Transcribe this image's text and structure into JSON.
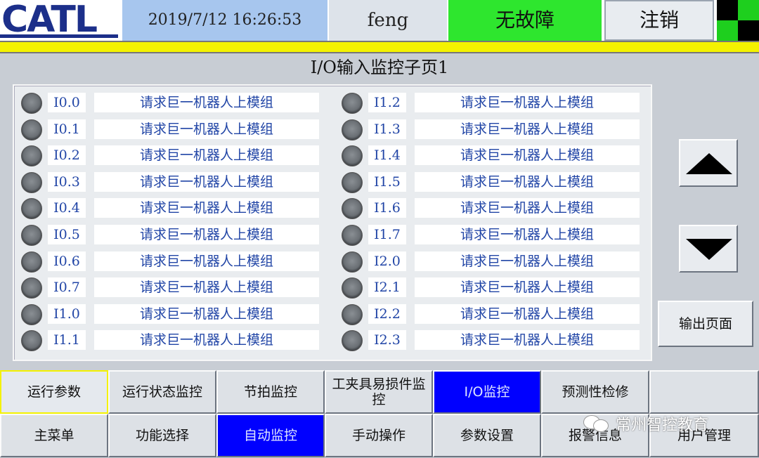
{
  "header": {
    "logo_text": "CATL",
    "datetime": "2019/7/12  16:26:53",
    "user": "feng",
    "status": "无故障",
    "logout_label": "注销"
  },
  "colors": {
    "status_ok": "#2ee62e",
    "active_tab": "#0000ff",
    "alarm_bar": "#f4f200",
    "datetime_bg": "#a7c6ee"
  },
  "page_title": "I/O输入监控子页1",
  "io_left": [
    {
      "addr": "I0.0",
      "desc": "请求巨一机器人上模组",
      "state": "off"
    },
    {
      "addr": "I0.1",
      "desc": "请求巨一机器人上模组",
      "state": "off"
    },
    {
      "addr": "I0.2",
      "desc": "请求巨一机器人上模组",
      "state": "off"
    },
    {
      "addr": "I0.3",
      "desc": "请求巨一机器人上模组",
      "state": "off"
    },
    {
      "addr": "I0.4",
      "desc": "请求巨一机器人上模组",
      "state": "off"
    },
    {
      "addr": "I0.5",
      "desc": "请求巨一机器人上模组",
      "state": "off"
    },
    {
      "addr": "I0.6",
      "desc": "请求巨一机器人上模组",
      "state": "off"
    },
    {
      "addr": "I0.7",
      "desc": "请求巨一机器人上模组",
      "state": "off"
    },
    {
      "addr": "I1.0",
      "desc": "请求巨一机器人上模组",
      "state": "off"
    },
    {
      "addr": "I1.1",
      "desc": "请求巨一机器人上模组",
      "state": "off"
    }
  ],
  "io_right": [
    {
      "addr": "I1.2",
      "desc": "请求巨一机器人上模组",
      "state": "off"
    },
    {
      "addr": "I1.3",
      "desc": "请求巨一机器人上模组",
      "state": "off"
    },
    {
      "addr": "I1.4",
      "desc": "请求巨一机器人上模组",
      "state": "off"
    },
    {
      "addr": "I1.5",
      "desc": "请求巨一机器人上模组",
      "state": "off"
    },
    {
      "addr": "I1.6",
      "desc": "请求巨一机器人上模组",
      "state": "off"
    },
    {
      "addr": "I1.7",
      "desc": "请求巨一机器人上模组",
      "state": "off"
    },
    {
      "addr": "I2.0",
      "desc": "请求巨一机器人上模组",
      "state": "off"
    },
    {
      "addr": "I2.1",
      "desc": "请求巨一机器人上模组",
      "state": "off"
    },
    {
      "addr": "I2.2",
      "desc": "请求巨一机器人上模组",
      "state": "off"
    },
    {
      "addr": "I2.3",
      "desc": "请求巨一机器人上模组",
      "state": "off"
    }
  ],
  "side": {
    "up_icon": "triangle-up-icon",
    "down_icon": "triangle-down-icon",
    "output_label": "输出页面"
  },
  "nav_top": [
    "运行参数",
    "运行状态监控",
    "节拍监控",
    "工夹具易损件监控",
    "I/O监控",
    "预测性检修",
    ""
  ],
  "nav_bottom": [
    "主菜单",
    "功能选择",
    "自动监控",
    "手动操作",
    "参数设置",
    "报警信息",
    "用户管理"
  ],
  "watermark": "常州智控教育"
}
